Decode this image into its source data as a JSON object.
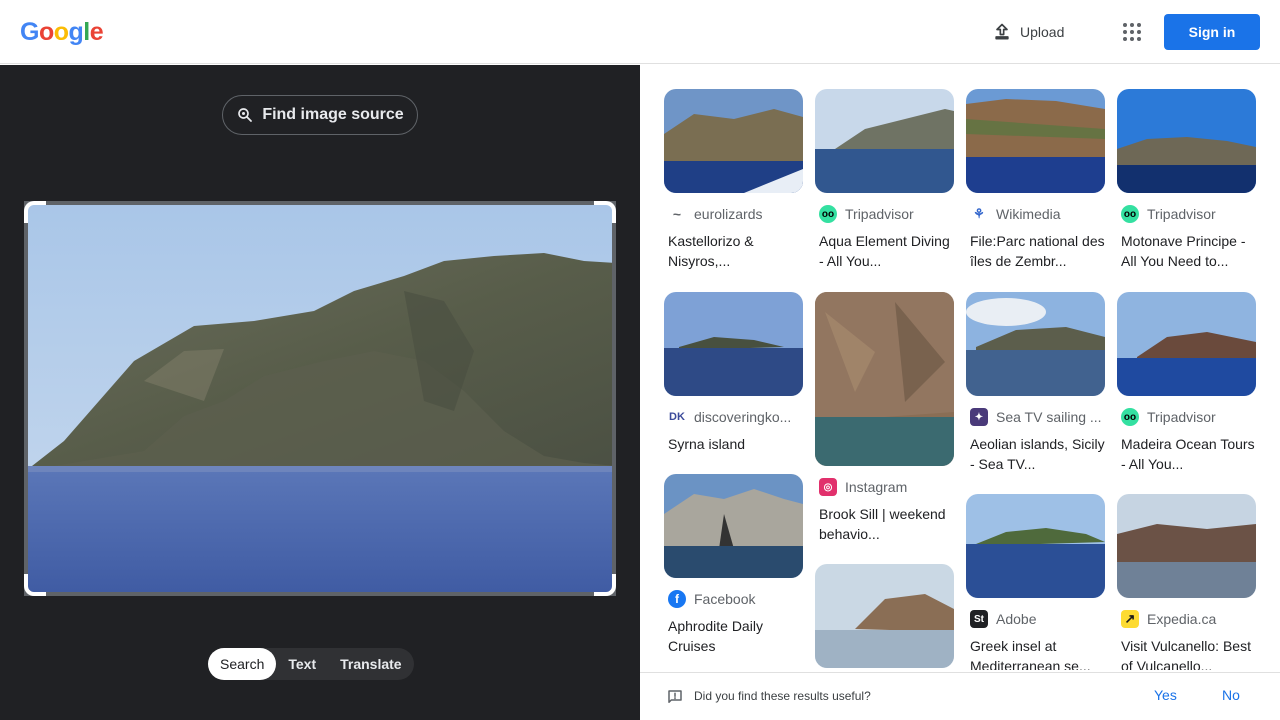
{
  "header": {
    "logo_letters": [
      {
        "ch": "G",
        "color": "#4285F4"
      },
      {
        "ch": "o",
        "color": "#EA4335"
      },
      {
        "ch": "o",
        "color": "#FBBC05"
      },
      {
        "ch": "g",
        "color": "#4285F4"
      },
      {
        "ch": "l",
        "color": "#34A853"
      },
      {
        "ch": "e",
        "color": "#EA4335"
      }
    ],
    "upload_label": "Upload",
    "apps_icon": "apps-grid-icon",
    "signin_label": "Sign in"
  },
  "left": {
    "find_source_label": "Find image source",
    "modes": [
      "Search",
      "Text",
      "Translate"
    ],
    "active_mode": "Search"
  },
  "results": [
    {
      "source": "eurolizards",
      "title": "Kastellorizo & Nisyros,...",
      "icon": "eurolizards-icon"
    },
    {
      "source": "Tripadvisor",
      "title": "Aqua Element Diving - All You...",
      "icon": "tripadvisor-icon"
    },
    {
      "source": "Wikimedia",
      "title": "File:Parc national des îles de Zembr...",
      "icon": "wikimedia-icon"
    },
    {
      "source": "Tripadvisor",
      "title": "Motonave Principe - All You Need to...",
      "icon": "tripadvisor-icon"
    },
    {
      "source": "discoveringko...",
      "title": "Syrna island",
      "icon": "discoveringkos-icon"
    },
    {
      "source": "Instagram",
      "title": "Brook Sill | weekend behavio...",
      "icon": "instagram-icon"
    },
    {
      "source": "Sea TV sailing ...",
      "title": "Aeolian islands, Sicily - Sea TV...",
      "icon": "seatv-icon"
    },
    {
      "source": "Tripadvisor",
      "title": "Madeira Ocean Tours - All You...",
      "icon": "tripadvisor-icon"
    },
    {
      "source": "Facebook",
      "title": "Aphrodite Daily Cruises",
      "icon": "facebook-icon"
    },
    {
      "source": "",
      "title": "",
      "icon": ""
    },
    {
      "source": "Adobe",
      "title": "Greek insel at Mediterranean se...",
      "icon": "adobe-stock-icon"
    },
    {
      "source": "Expedia.ca",
      "title": "Visit Vulcanello: Best of Vulcanello...",
      "icon": "expedia-icon"
    }
  ],
  "feedback": {
    "question": "Did you find these results useful?",
    "yes": "Yes",
    "no": "No"
  },
  "colors": {
    "accent": "#1a73e8",
    "dark_panel": "#202124",
    "tripadvisor": "#34E0A1",
    "facebook": "#1877F2",
    "instagram": "#E1306C",
    "expedia": "#FDDB32"
  }
}
